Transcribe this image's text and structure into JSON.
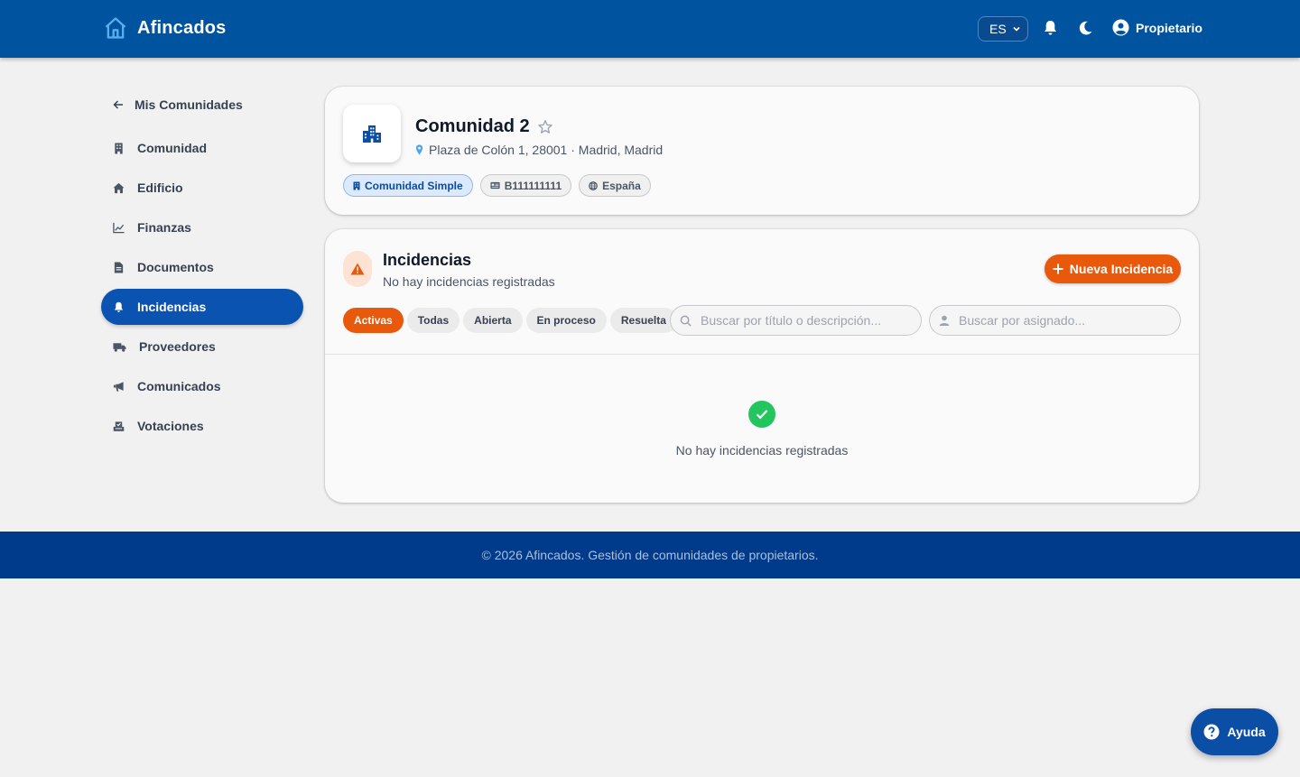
{
  "header": {
    "app_name": "Afincados",
    "language": "ES",
    "user_label": "Propietario"
  },
  "sidebar": {
    "back_label": "Mis Comunidades",
    "items": [
      {
        "label": "Comunidad",
        "icon": "building-icon"
      },
      {
        "label": "Edificio",
        "icon": "home-icon"
      },
      {
        "label": "Finanzas",
        "icon": "chart-icon"
      },
      {
        "label": "Documentos",
        "icon": "document-icon"
      },
      {
        "label": "Incidencias",
        "icon": "bell-icon",
        "active": true
      },
      {
        "label": "Proveedores",
        "icon": "truck-icon"
      },
      {
        "label": "Comunicados",
        "icon": "megaphone-icon"
      },
      {
        "label": "Votaciones",
        "icon": "ballot-box-icon"
      }
    ]
  },
  "community": {
    "name": "Comunidad 2",
    "address": "Plaza de Colón 1, 28001 · Madrid, Madrid",
    "chips": {
      "type": "Comunidad Simple",
      "cif": "B111111111",
      "country": "España"
    }
  },
  "incidents": {
    "title": "Incidencias",
    "subtitle": "No hay incidencias registradas",
    "new_button": "Nueva Incidencia",
    "filters": [
      "Activas",
      "Todas",
      "Abierta",
      "En proceso",
      "Resuelta"
    ],
    "active_filter": "Activas",
    "search_placeholder": "Buscar por título o descripción...",
    "assignee_placeholder": "Buscar por asignado...",
    "empty_text": "No hay incidencias registradas"
  },
  "footer": {
    "text": "© 2026 Afincados. Gestión de comunidades de propietarios."
  },
  "help": {
    "label": "Ayuda"
  },
  "colors": {
    "primary": "#00539f",
    "accent": "#e8590c",
    "success": "#22c55e",
    "footer": "#003b8b"
  }
}
